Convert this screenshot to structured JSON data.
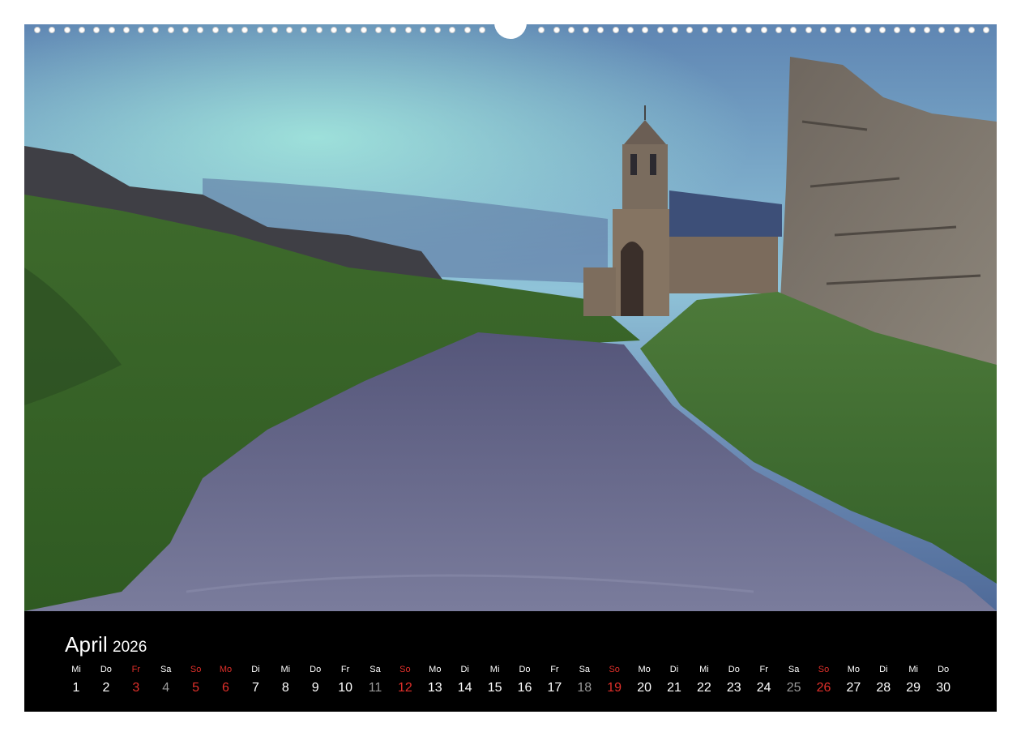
{
  "calendar": {
    "month": "April",
    "year": "2026",
    "days": [
      {
        "weekday": "Mi",
        "day": "1"
      },
      {
        "weekday": "Do",
        "day": "2"
      },
      {
        "weekday": "Fr",
        "day": "3",
        "red": true
      },
      {
        "weekday": "Sa",
        "day": "4",
        "grey": true
      },
      {
        "weekday": "So",
        "day": "5",
        "red": true
      },
      {
        "weekday": "Mo",
        "day": "6",
        "red": true
      },
      {
        "weekday": "Di",
        "day": "7"
      },
      {
        "weekday": "Mi",
        "day": "8"
      },
      {
        "weekday": "Do",
        "day": "9"
      },
      {
        "weekday": "Fr",
        "day": "10"
      },
      {
        "weekday": "Sa",
        "day": "11",
        "grey": true
      },
      {
        "weekday": "So",
        "day": "12",
        "red": true
      },
      {
        "weekday": "Mo",
        "day": "13"
      },
      {
        "weekday": "Di",
        "day": "14"
      },
      {
        "weekday": "Mi",
        "day": "15"
      },
      {
        "weekday": "Do",
        "day": "16"
      },
      {
        "weekday": "Fr",
        "day": "17"
      },
      {
        "weekday": "Sa",
        "day": "18",
        "grey": true
      },
      {
        "weekday": "So",
        "day": "19",
        "red": true
      },
      {
        "weekday": "Mo",
        "day": "20"
      },
      {
        "weekday": "Di",
        "day": "21"
      },
      {
        "weekday": "Mi",
        "day": "22"
      },
      {
        "weekday": "Do",
        "day": "23"
      },
      {
        "weekday": "Fr",
        "day": "24"
      },
      {
        "weekday": "Sa",
        "day": "25",
        "grey": true
      },
      {
        "weekday": "So",
        "day": "26",
        "red": true
      },
      {
        "weekday": "Mo",
        "day": "27"
      },
      {
        "weekday": "Di",
        "day": "28"
      },
      {
        "weekday": "Mi",
        "day": "29"
      },
      {
        "weekday": "Do",
        "day": "30"
      }
    ]
  },
  "colors": {
    "background": "#000000",
    "text": "#ffffff",
    "holiday": "#e0302a",
    "saturday": "#9a9a9a"
  }
}
